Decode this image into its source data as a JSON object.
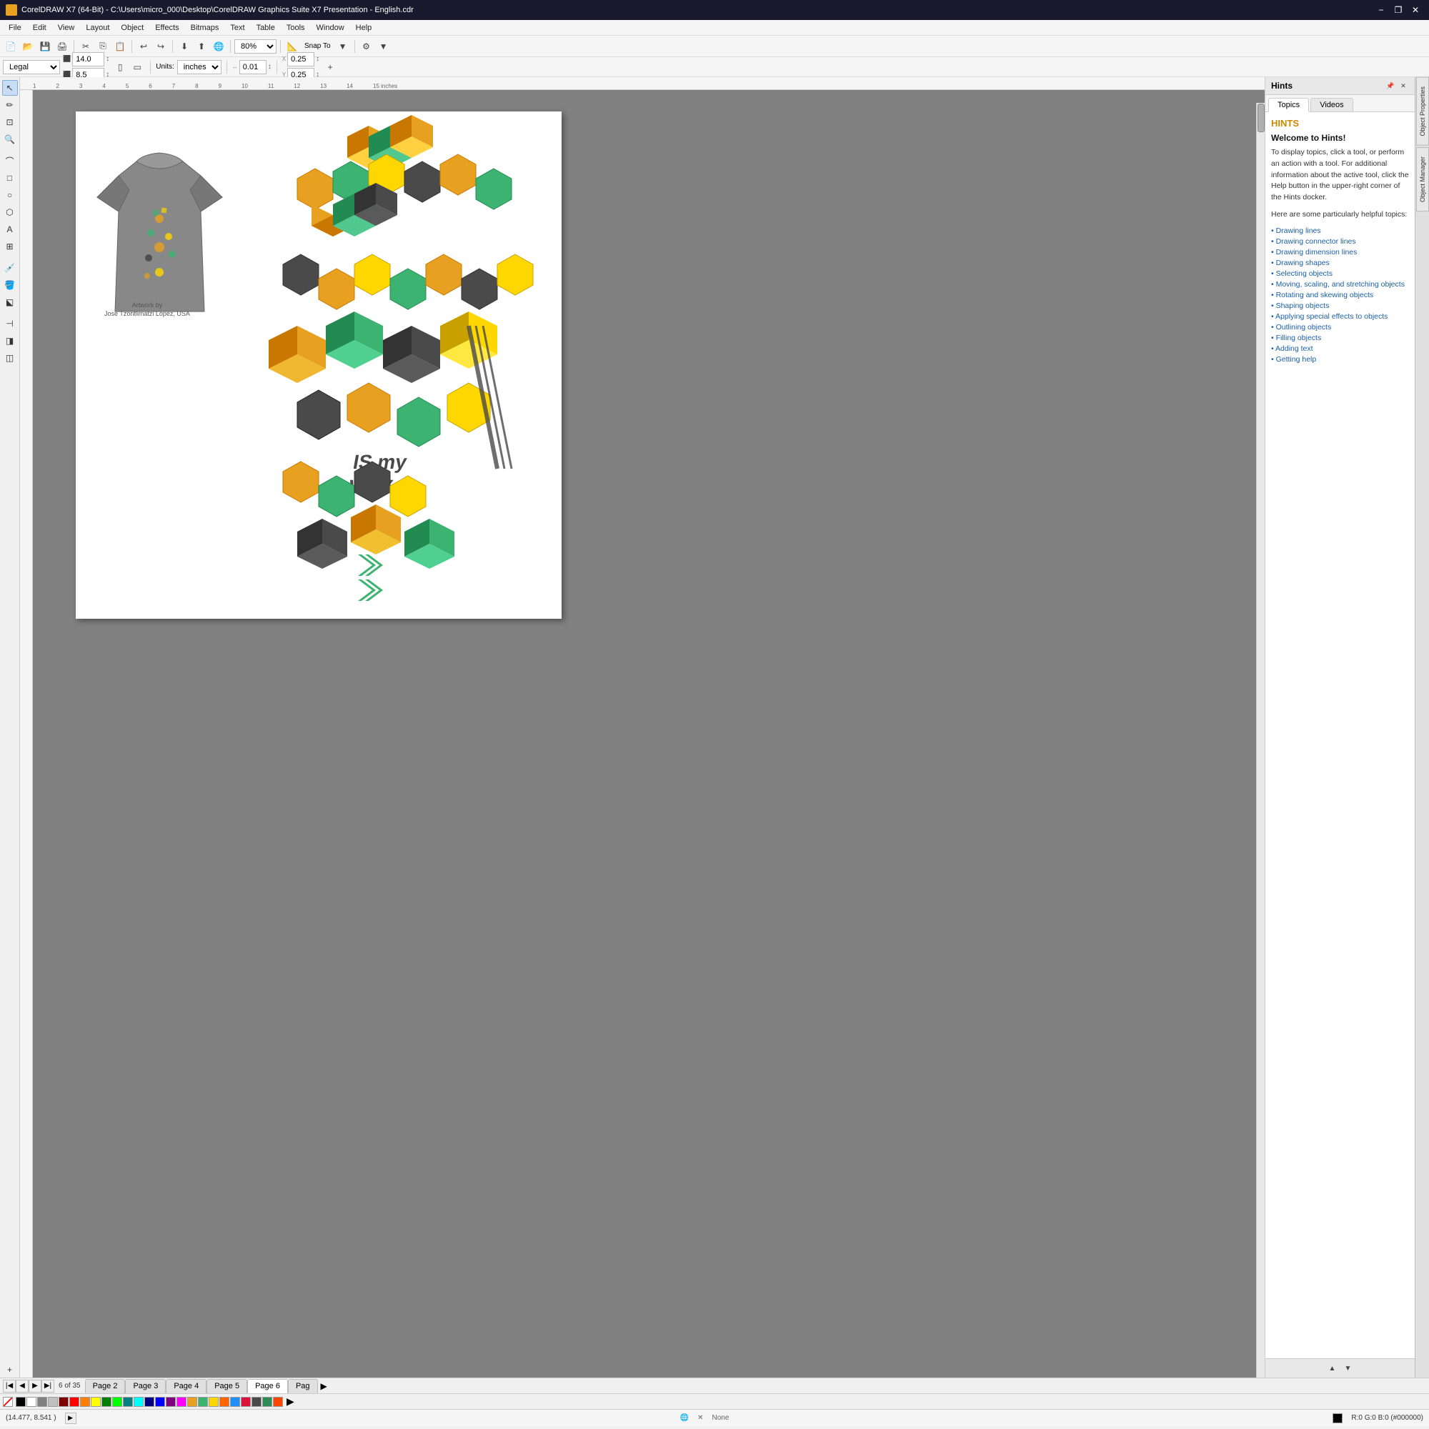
{
  "titlebar": {
    "icon_color": "#e8a020",
    "title": "CorelDRAW X7 (64-Bit) - C:\\Users\\micro_000\\Desktop\\CorelDRAW Graphics Suite X7 Presentation - English.cdr",
    "minimize": "−",
    "restore": "❐",
    "close": "✕"
  },
  "menu": {
    "items": [
      "File",
      "Edit",
      "View",
      "Layout",
      "Object",
      "Effects",
      "Bitmaps",
      "Text",
      "Table",
      "Tools",
      "Window",
      "Help"
    ]
  },
  "toolbar": {
    "zoom_level": "80%",
    "snap_to": "Snap To",
    "units": "inches",
    "width": "14.0",
    "height": "8.5",
    "x_offset": "0.25",
    "y_offset": "0.25",
    "step": "0.01"
  },
  "page_selector": {
    "label": "Legal"
  },
  "hints": {
    "panel_title": "Hints",
    "tab_topics": "Topics",
    "tab_videos": "Videos",
    "section_title": "HINTS",
    "welcome_title": "Welcome to Hints!",
    "description": "To display topics, click a tool, or perform an action with a tool. For additional information about the active tool, click the Help button in the upper-right corner of the Hints docker.",
    "helpful_text": "Here are some particularly helpful topics:",
    "links": [
      "Drawing lines",
      "Drawing connector lines",
      "Drawing dimension lines",
      "Drawing shapes",
      "Selecting objects",
      "Moving, scaling, and stretching objects",
      "Rotating and skewing objects",
      "Shaping objects",
      "Applying special effects to objects",
      "Outlining objects",
      "Filling objects",
      "Adding text",
      "Getting help"
    ]
  },
  "side_panels": {
    "object_properties": "Object Properties",
    "object_manager": "Object Manager"
  },
  "pages": {
    "current_page": "6 of 35",
    "tabs": [
      "Page 2",
      "Page 3",
      "Page 4",
      "Page 5",
      "Page 6",
      "Pag"
    ]
  },
  "status": {
    "coordinates": "(14.477, 8.541 )",
    "color_info": "R:0 G:0 B:0 (#000000)",
    "fill_indicator": "None"
  },
  "artwork": {
    "attribution": "Artwork by",
    "artist": "José Tzontlimatzi López, USA"
  },
  "colors": {
    "palette": [
      "#000000",
      "#ffffff",
      "#808080",
      "#c0c0c0",
      "#800000",
      "#ff0000",
      "#ff8000",
      "#ffff00",
      "#008000",
      "#00ff00",
      "#008080",
      "#00ffff",
      "#000080",
      "#0000ff",
      "#800080",
      "#ff00ff",
      "#c0a000",
      "#e8a020",
      "#3cb371",
      "#ffd700",
      "#ff6600",
      "#4a4a4a",
      "#2e8b57",
      "#1e90ff",
      "#dc143c",
      "#ff4500"
    ]
  }
}
